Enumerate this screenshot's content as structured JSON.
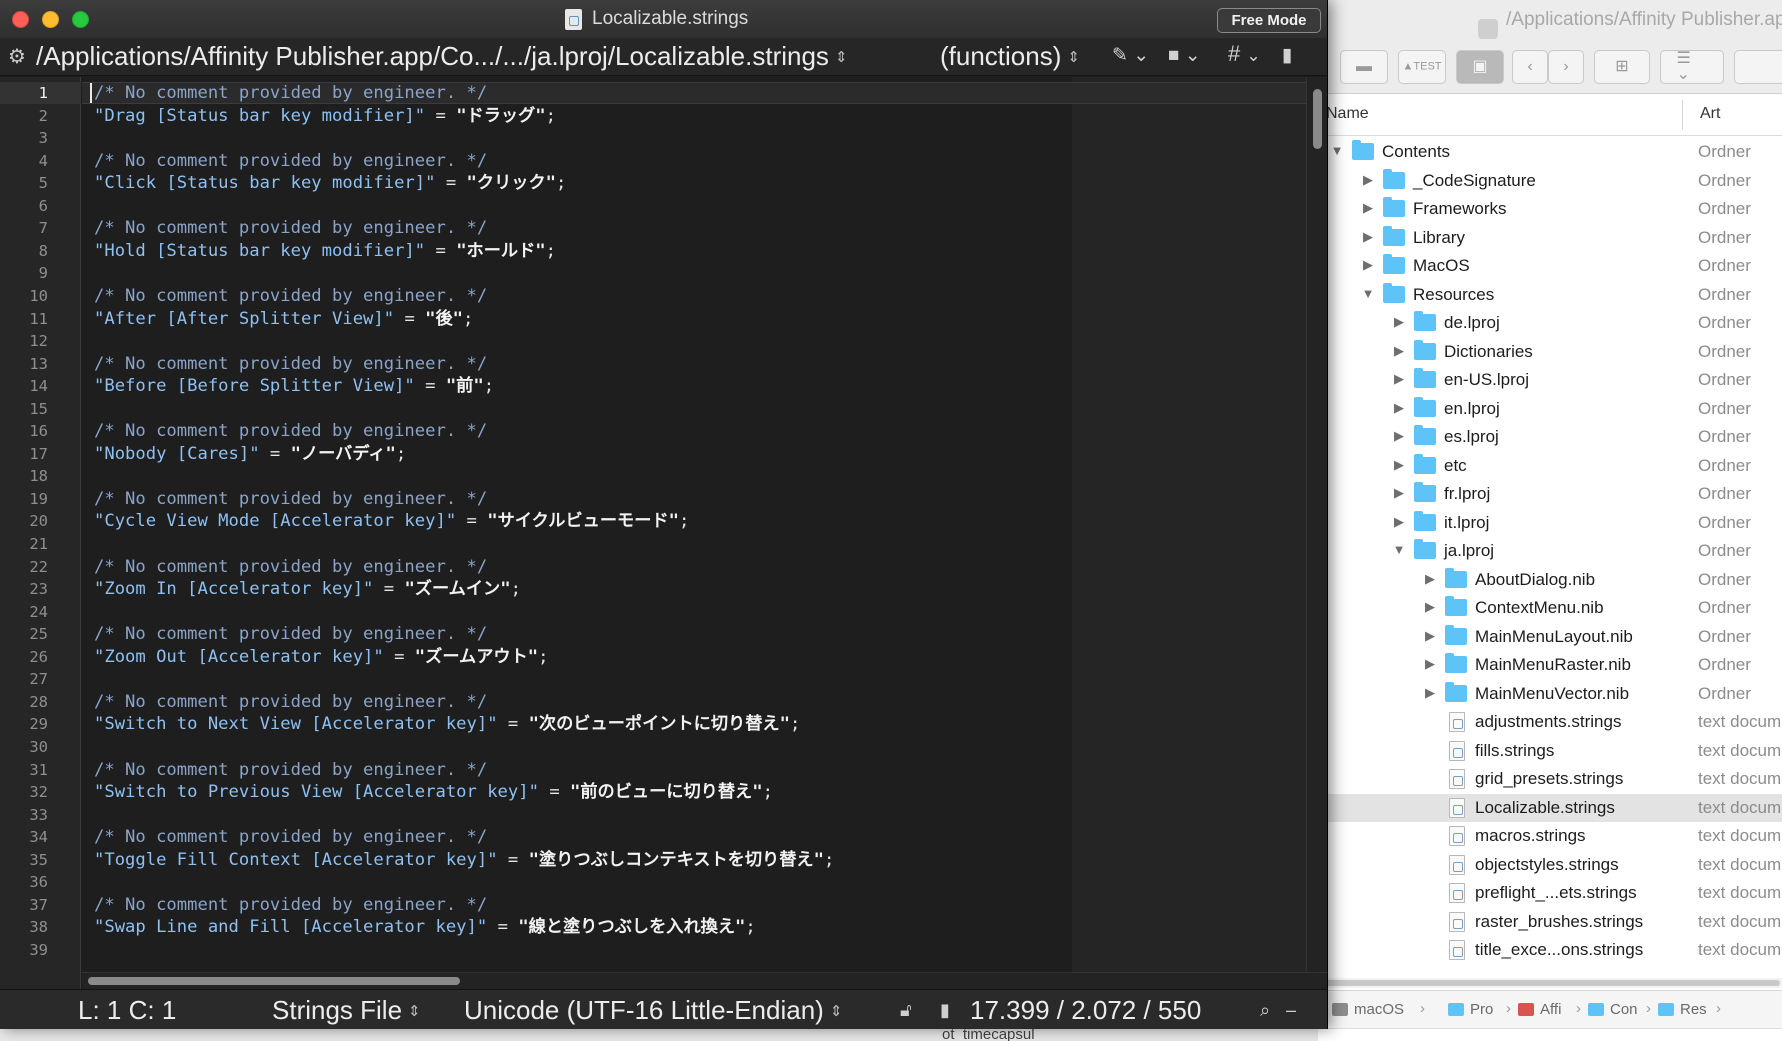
{
  "editor": {
    "window_title": "Localizable.strings",
    "free_mode_label": "Free Mode",
    "path": "/Applications/Affinity Publisher.app/Co.../.../ja.lproj/Localizable.strings",
    "functions_label": "(functions)",
    "nav_icons": [
      "pen-icon",
      "square-icon",
      "hash-icon",
      "document-icon"
    ],
    "current_line": 1,
    "lines": [
      {
        "n": "1",
        "type": "comment",
        "text": "/* No comment provided by engineer. */"
      },
      {
        "n": "2",
        "type": "entry",
        "key": "\"Drag [Status bar key modifier]\"",
        "value": "\"ドラッグ\""
      },
      {
        "n": "3",
        "type": "blank"
      },
      {
        "n": "4",
        "type": "comment",
        "text": "/* No comment provided by engineer. */"
      },
      {
        "n": "5",
        "type": "entry",
        "key": "\"Click [Status bar key modifier]\"",
        "value": "\"クリック\""
      },
      {
        "n": "6",
        "type": "blank"
      },
      {
        "n": "7",
        "type": "comment",
        "text": "/* No comment provided by engineer. */"
      },
      {
        "n": "8",
        "type": "entry",
        "key": "\"Hold [Status bar key modifier]\"",
        "value": "\"ホールド\""
      },
      {
        "n": "9",
        "type": "blank"
      },
      {
        "n": "10",
        "type": "comment",
        "text": "/* No comment provided by engineer. */"
      },
      {
        "n": "11",
        "type": "entry",
        "key": "\"After [After Splitter View]\"",
        "value": "\"後\""
      },
      {
        "n": "12",
        "type": "blank"
      },
      {
        "n": "13",
        "type": "comment",
        "text": "/* No comment provided by engineer. */"
      },
      {
        "n": "14",
        "type": "entry",
        "key": "\"Before [Before Splitter View]\"",
        "value": "\"前\""
      },
      {
        "n": "15",
        "type": "blank"
      },
      {
        "n": "16",
        "type": "comment",
        "text": "/* No comment provided by engineer. */"
      },
      {
        "n": "17",
        "type": "entry",
        "key": "\"Nobody [Cares]\"",
        "value": "\"ノーバディ\""
      },
      {
        "n": "18",
        "type": "blank"
      },
      {
        "n": "19",
        "type": "comment",
        "text": "/* No comment provided by engineer. */"
      },
      {
        "n": "20",
        "type": "entry",
        "key": "\"Cycle View Mode [Accelerator key]\"",
        "value": "\"サイクルビューモード\""
      },
      {
        "n": "21",
        "type": "blank"
      },
      {
        "n": "22",
        "type": "comment",
        "text": "/* No comment provided by engineer. */"
      },
      {
        "n": "23",
        "type": "entry",
        "key": "\"Zoom In [Accelerator key]\"",
        "value": "\"ズームイン\""
      },
      {
        "n": "24",
        "type": "blank"
      },
      {
        "n": "25",
        "type": "comment",
        "text": "/* No comment provided by engineer. */"
      },
      {
        "n": "26",
        "type": "entry",
        "key": "\"Zoom Out [Accelerator key]\"",
        "value": "\"ズームアウト\""
      },
      {
        "n": "27",
        "type": "blank"
      },
      {
        "n": "28",
        "type": "comment",
        "text": "/* No comment provided by engineer. */"
      },
      {
        "n": "29",
        "type": "entry",
        "key": "\"Switch to Next View [Accelerator key]\"",
        "value": "\"次のビューポイントに切り替え\""
      },
      {
        "n": "30",
        "type": "blank"
      },
      {
        "n": "31",
        "type": "comment",
        "text": "/* No comment provided by engineer. */"
      },
      {
        "n": "32",
        "type": "entry",
        "key": "\"Switch to Previous View [Accelerator key]\"",
        "value": "\"前のビューに切り替え\""
      },
      {
        "n": "33",
        "type": "blank"
      },
      {
        "n": "34",
        "type": "comment",
        "text": "/* No comment provided by engineer. */"
      },
      {
        "n": "35",
        "type": "entry",
        "key": "\"Toggle Fill Context [Accelerator key]\"",
        "value": "\"塗りつぶしコンテキストを切り替え\""
      },
      {
        "n": "36",
        "type": "blank"
      },
      {
        "n": "37",
        "type": "comment",
        "text": "/* No comment provided by engineer. */"
      },
      {
        "n": "38",
        "type": "entry",
        "key": "\"Swap Line and Fill [Accelerator key]\"",
        "value": "\"線と塗りつぶしを入れ換え\""
      },
      {
        "n": "39",
        "type": "blank"
      }
    ],
    "status": {
      "position": "L: 1 C: 1",
      "language": "Strings File",
      "encoding": "Unicode (UTF-16 Little-Endian)",
      "counts": "17.399 / 2.072 / 550"
    }
  },
  "finder": {
    "title": "/Applications/Affinity Publisher.app",
    "columns": {
      "name": "Name",
      "kind": "Art"
    },
    "rows": [
      {
        "name": "Contents",
        "kind": "Ordner",
        "depth": 0,
        "type": "folder",
        "expanded": true
      },
      {
        "name": "_CodeSignature",
        "kind": "Ordner",
        "depth": 1,
        "type": "folder",
        "expanded": false
      },
      {
        "name": "Frameworks",
        "kind": "Ordner",
        "depth": 1,
        "type": "folder",
        "expanded": false
      },
      {
        "name": "Library",
        "kind": "Ordner",
        "depth": 1,
        "type": "folder",
        "expanded": false
      },
      {
        "name": "MacOS",
        "kind": "Ordner",
        "depth": 1,
        "type": "folder",
        "expanded": false
      },
      {
        "name": "Resources",
        "kind": "Ordner",
        "depth": 1,
        "type": "folder",
        "expanded": true
      },
      {
        "name": "de.lproj",
        "kind": "Ordner",
        "depth": 2,
        "type": "folder",
        "expanded": false
      },
      {
        "name": "Dictionaries",
        "kind": "Ordner",
        "depth": 2,
        "type": "folder",
        "expanded": false
      },
      {
        "name": "en-US.lproj",
        "kind": "Ordner",
        "depth": 2,
        "type": "folder",
        "expanded": false
      },
      {
        "name": "en.lproj",
        "kind": "Ordner",
        "depth": 2,
        "type": "folder",
        "expanded": false
      },
      {
        "name": "es.lproj",
        "kind": "Ordner",
        "depth": 2,
        "type": "folder",
        "expanded": false
      },
      {
        "name": "etc",
        "kind": "Ordner",
        "depth": 2,
        "type": "folder",
        "expanded": false
      },
      {
        "name": "fr.lproj",
        "kind": "Ordner",
        "depth": 2,
        "type": "folder",
        "expanded": false
      },
      {
        "name": "it.lproj",
        "kind": "Ordner",
        "depth": 2,
        "type": "folder",
        "expanded": false
      },
      {
        "name": "ja.lproj",
        "kind": "Ordner",
        "depth": 2,
        "type": "folder",
        "expanded": true
      },
      {
        "name": "AboutDialog.nib",
        "kind": "Ordner",
        "depth": 3,
        "type": "folder",
        "expanded": false
      },
      {
        "name": "ContextMenu.nib",
        "kind": "Ordner",
        "depth": 3,
        "type": "folder",
        "expanded": false
      },
      {
        "name": "MainMenuLayout.nib",
        "kind": "Ordner",
        "depth": 3,
        "type": "folder",
        "expanded": false
      },
      {
        "name": "MainMenuRaster.nib",
        "kind": "Ordner",
        "depth": 3,
        "type": "folder",
        "expanded": false
      },
      {
        "name": "MainMenuVector.nib",
        "kind": "Ordner",
        "depth": 3,
        "type": "folder",
        "expanded": false
      },
      {
        "name": "adjustments.strings",
        "kind": "text docum",
        "depth": 3,
        "type": "file"
      },
      {
        "name": "fills.strings",
        "kind": "text docum",
        "depth": 3,
        "type": "file"
      },
      {
        "name": "grid_presets.strings",
        "kind": "text docum",
        "depth": 3,
        "type": "file"
      },
      {
        "name": "Localizable.strings",
        "kind": "text docum",
        "depth": 3,
        "type": "file",
        "selected": true
      },
      {
        "name": "macros.strings",
        "kind": "text docum",
        "depth": 3,
        "type": "file"
      },
      {
        "name": "objectstyles.strings",
        "kind": "text docum",
        "depth": 3,
        "type": "file"
      },
      {
        "name": "preflight_...ets.strings",
        "kind": "text docum",
        "depth": 3,
        "type": "file"
      },
      {
        "name": "raster_brushes.strings",
        "kind": "text docum",
        "depth": 3,
        "type": "file"
      },
      {
        "name": "title_exce...ons.strings",
        "kind": "text docum",
        "depth": 3,
        "type": "file"
      }
    ],
    "pathbar": [
      "macOS",
      "Pro",
      "Affi",
      "Con",
      "Res"
    ],
    "backdrop_text": "ot_timecapsul"
  }
}
